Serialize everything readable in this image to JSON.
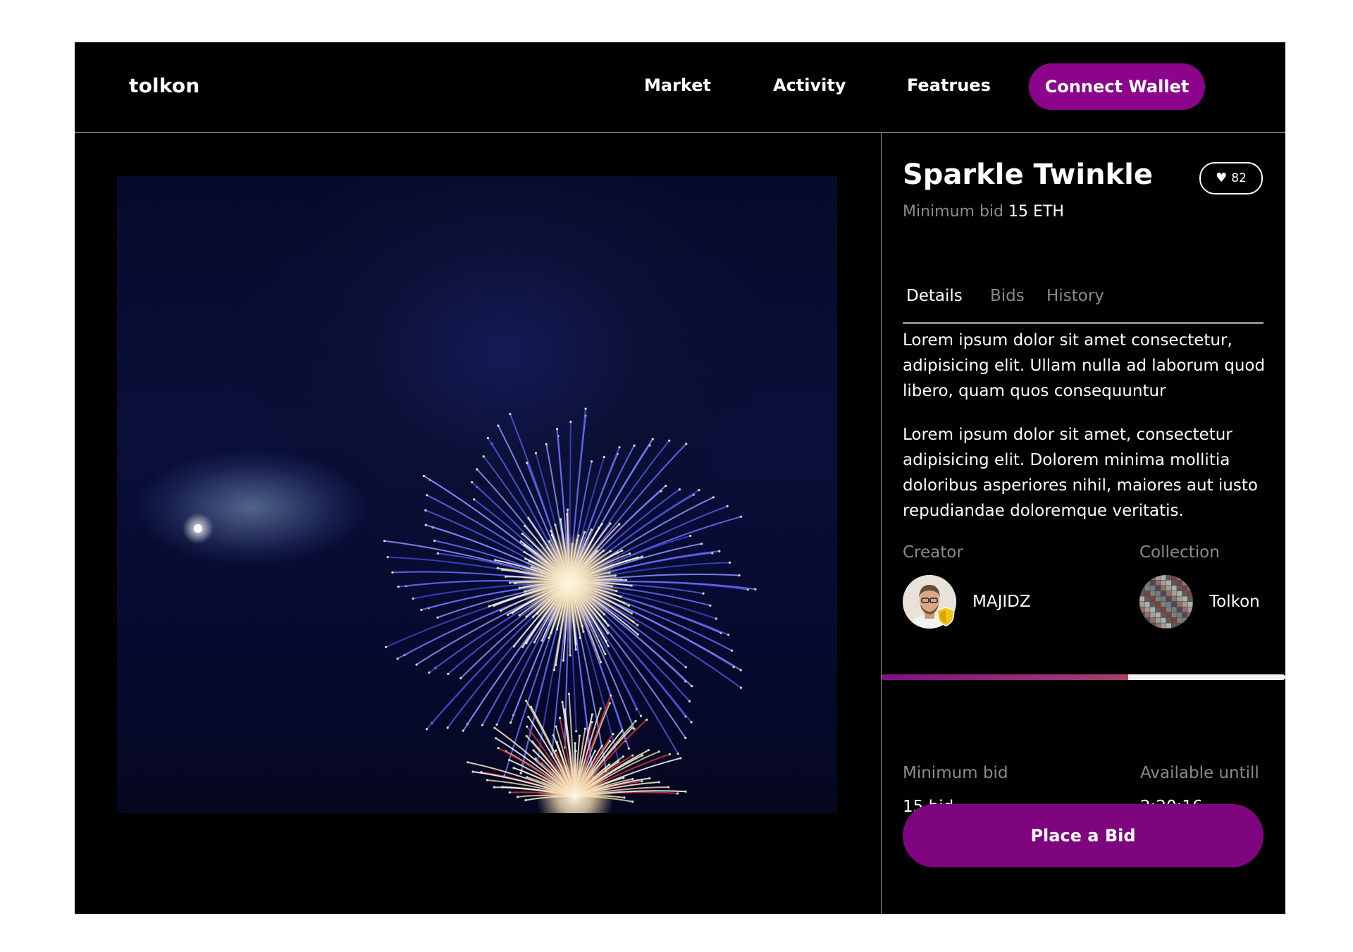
{
  "header": {
    "logo": "tolkon",
    "nav": [
      "Market",
      "Activity",
      "Featrues"
    ],
    "connect_label": "Connect Wallet"
  },
  "item": {
    "title": "Sparkle Twinkle",
    "likes": "82",
    "min_bid_label": "Minimum bid",
    "min_bid_value": "15 ETH"
  },
  "tabs": [
    {
      "label": "Details",
      "active": true
    },
    {
      "label": "Bids",
      "active": false
    },
    {
      "label": "History",
      "active": false
    }
  ],
  "details": {
    "paragraph1": "Lorem ipsum dolor sit amet consectetur, adipisicing elit. Ullam nulla ad laborum quod libero, quam quos consequuntur",
    "paragraph2": "Lorem ipsum dolor sit amet, consectetur adipisicing elit. Dolorem minima mollitia doloribus asperiores nihil, maiores aut iusto repudiandae doloremque veritatis."
  },
  "owners": {
    "creator_label": "Creator",
    "creator_name": "MAJIDZ",
    "collection_label": "Collection",
    "collection_name": "Tolkon"
  },
  "auction": {
    "progress_fraction": 0.61,
    "min_bid_label": "Minimum bid",
    "min_bid_value": "15 bid",
    "available_label": "Available untill",
    "available_value": "2:20:16"
  },
  "actions": {
    "place_bid_label": "Place a Bid"
  },
  "colors": {
    "accent": "#8b048b",
    "background": "#000000",
    "muted_text": "#8a8a8a"
  }
}
